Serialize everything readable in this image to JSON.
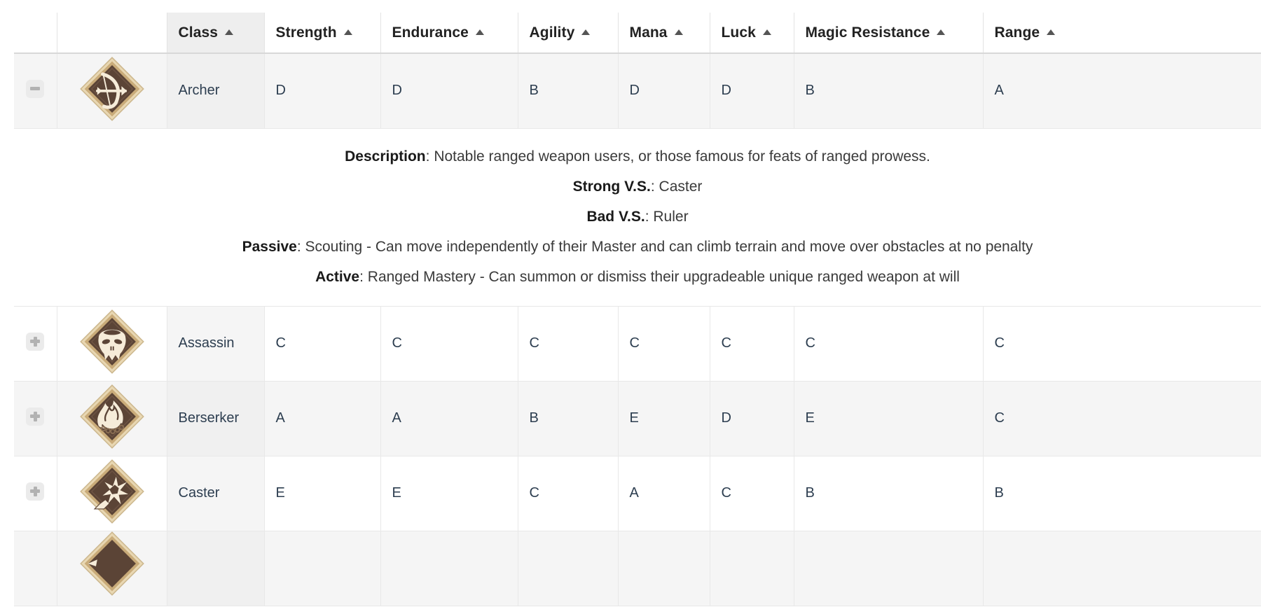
{
  "table": {
    "columns": [
      {
        "key": "toggle",
        "label": "",
        "sortable": false,
        "sorted": false
      },
      {
        "key": "emblem",
        "label": "",
        "sortable": false,
        "sorted": false
      },
      {
        "key": "class",
        "label": "Class",
        "sortable": true,
        "sorted": true
      },
      {
        "key": "strength",
        "label": "Strength",
        "sortable": true,
        "sorted": false
      },
      {
        "key": "endurance",
        "label": "Endurance",
        "sortable": true,
        "sorted": false
      },
      {
        "key": "agility",
        "label": "Agility",
        "sortable": true,
        "sorted": false
      },
      {
        "key": "mana",
        "label": "Mana",
        "sortable": true,
        "sorted": false
      },
      {
        "key": "luck",
        "label": "Luck",
        "sortable": true,
        "sorted": false
      },
      {
        "key": "magic_resistance",
        "label": "Magic Resistance",
        "sortable": true,
        "sorted": false
      },
      {
        "key": "range",
        "label": "Range",
        "sortable": true,
        "sorted": false
      }
    ],
    "sort": {
      "column": "Class",
      "direction": "asc",
      "caret": "ascending-caret"
    },
    "rows": [
      {
        "class": "Archer",
        "icon": "archer-bow-emblem-icon",
        "expanded": true,
        "toggle_icon": "minus-icon",
        "toggle_label": "-",
        "stats": [
          "D",
          "D",
          "B",
          "D",
          "D",
          "B",
          "A"
        ],
        "detail": {
          "description_label": "Description",
          "description_value": "Notable ranged weapon users, or those famous for feats of ranged prowess.",
          "strong_vs_label": "Strong V.S.",
          "strong_vs_value": "Caster",
          "bad_vs_label": "Bad V.S.",
          "bad_vs_value": "Ruler",
          "passive_label": "Passive",
          "passive_value": "Scouting - Can move independently of their Master and can climb terrain and move over obstacles at no penalty",
          "active_label": "Active",
          "active_value": "Ranged Mastery - Can summon or dismiss their upgradeable unique ranged weapon at will"
        }
      },
      {
        "class": "Assassin",
        "icon": "assassin-skull-emblem-icon",
        "expanded": false,
        "toggle_icon": "plus-icon",
        "toggle_label": "+",
        "stats": [
          "C",
          "C",
          "C",
          "C",
          "C",
          "C",
          "C"
        ]
      },
      {
        "class": "Berserker",
        "icon": "berserker-flame-chain-emblem-icon",
        "expanded": false,
        "toggle_icon": "plus-icon",
        "toggle_label": "+",
        "stats": [
          "A",
          "A",
          "B",
          "E",
          "D",
          "E",
          "C"
        ]
      },
      {
        "class": "Caster",
        "icon": "caster-wand-star-emblem-icon",
        "expanded": false,
        "toggle_icon": "plus-icon",
        "toggle_label": "+",
        "stats": [
          "E",
          "E",
          "C",
          "A",
          "C",
          "B",
          "B"
        ]
      },
      {
        "class": "",
        "icon": "partial-emblem-icon",
        "expanded": false,
        "toggle_icon": "plus-icon",
        "toggle_label": "+",
        "stats": [
          "",
          "",
          "",
          "",
          "",
          "",
          ""
        ]
      }
    ]
  },
  "colors": {
    "header_text": "#222222",
    "cell_text": "#2d3e50",
    "sorted_header_bg": "#eeeeee",
    "row_shaded_bg": "#f5f5f5",
    "row_plain_bg": "#ffffff",
    "border": "#e8e8e8",
    "emblem_gold": "#d9c39a",
    "emblem_dark": "#554033",
    "emblem_cream": "#f6ecd9"
  }
}
